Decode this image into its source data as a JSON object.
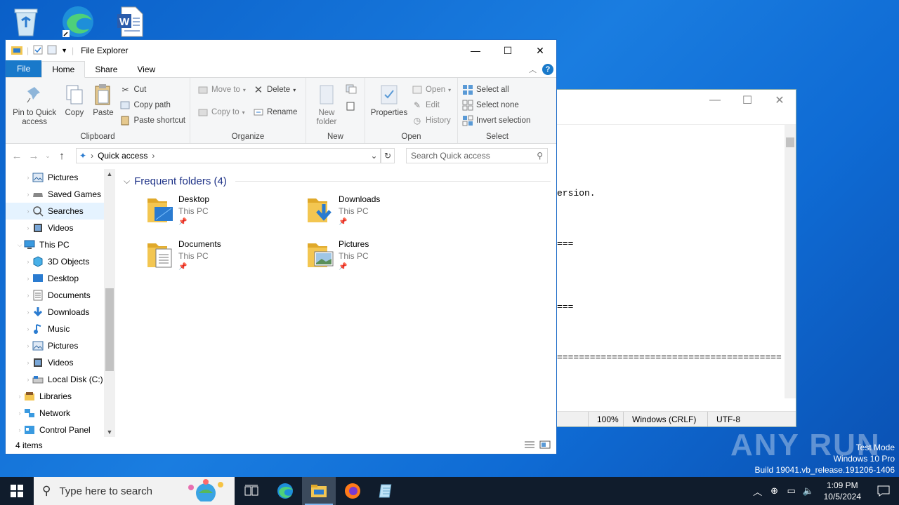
{
  "desktop": {
    "icons": [
      "recycle-bin-icon",
      "edge-shortcut-icon",
      "word-document-icon"
    ]
  },
  "notepad": {
    "lines": [
      "",
      "",
      "",
      "",
      "",
      "ersion.",
      "",
      "",
      "",
      "===",
      "",
      "",
      "",
      "",
      "===",
      "",
      "",
      "",
      "=========================================="
    ],
    "status": {
      "zoom": "100%",
      "eol": "Windows (CRLF)",
      "encoding": "UTF-8"
    }
  },
  "explorer": {
    "title": "File Explorer",
    "tabs": {
      "file": "File",
      "home": "Home",
      "share": "Share",
      "view": "View"
    },
    "ribbon": {
      "clipboard": {
        "label": "Clipboard",
        "pin": "Pin to Quick access",
        "copy": "Copy",
        "paste": "Paste",
        "cut": "Cut",
        "copy_path": "Copy path",
        "paste_shortcut": "Paste shortcut"
      },
      "organize": {
        "label": "Organize",
        "move_to": "Move to",
        "copy_to": "Copy to",
        "delete": "Delete",
        "rename": "Rename"
      },
      "new": {
        "label": "New",
        "new_folder": "New folder"
      },
      "open": {
        "label": "Open",
        "properties": "Properties",
        "open": "Open",
        "edit": "Edit",
        "history": "History"
      },
      "select": {
        "label": "Select",
        "select_all": "Select all",
        "select_none": "Select none",
        "invert": "Invert selection"
      }
    },
    "address": {
      "crumb": "Quick access"
    },
    "search": {
      "placeholder": "Search Quick access"
    },
    "nav": [
      {
        "label": "Pictures",
        "icon": "pictures-icon",
        "level": 1
      },
      {
        "label": "Saved Games",
        "icon": "saved-games-icon",
        "level": 1
      },
      {
        "label": "Searches",
        "icon": "search-icon",
        "level": 1,
        "selected": true
      },
      {
        "label": "Videos",
        "icon": "videos-icon",
        "level": 1
      },
      {
        "label": "This PC",
        "icon": "computer-icon",
        "level": 0,
        "expanded": true
      },
      {
        "label": "3D Objects",
        "icon": "3d-objects-icon",
        "level": 1
      },
      {
        "label": "Desktop",
        "icon": "desktop-icon",
        "level": 1
      },
      {
        "label": "Documents",
        "icon": "documents-icon",
        "level": 1
      },
      {
        "label": "Downloads",
        "icon": "downloads-icon",
        "level": 1
      },
      {
        "label": "Music",
        "icon": "music-icon",
        "level": 1
      },
      {
        "label": "Pictures",
        "icon": "pictures-icon",
        "level": 1
      },
      {
        "label": "Videos",
        "icon": "videos-icon",
        "level": 1
      },
      {
        "label": "Local Disk (C:)",
        "icon": "disk-icon",
        "level": 1
      },
      {
        "label": "Libraries",
        "icon": "libraries-icon",
        "level": 0
      },
      {
        "label": "Network",
        "icon": "network-icon",
        "level": 0
      },
      {
        "label": "Control Panel",
        "icon": "control-panel-icon",
        "level": 0
      }
    ],
    "frequent": {
      "heading": "Frequent folders (4)",
      "folders": [
        {
          "name": "Desktop",
          "location": "This PC",
          "icon": "desktop-folder-icon"
        },
        {
          "name": "Downloads",
          "location": "This PC",
          "icon": "downloads-folder-icon"
        },
        {
          "name": "Documents",
          "location": "This PC",
          "icon": "documents-folder-icon"
        },
        {
          "name": "Pictures",
          "location": "This PC",
          "icon": "pictures-folder-icon"
        }
      ]
    },
    "status": {
      "items": "4 items"
    }
  },
  "watermark": {
    "brand": "ANY RUN",
    "mode": "Test Mode",
    "os": "Windows 10 Pro",
    "build": "Build 19041.vb_release.191206-1406"
  },
  "taskbar": {
    "search_placeholder": "Type here to search",
    "time": "1:09 PM",
    "date": "10/5/2024"
  },
  "colors": {
    "accent": "#1979ca",
    "taskbar": "#101c2c",
    "folder": "#f3c651"
  }
}
